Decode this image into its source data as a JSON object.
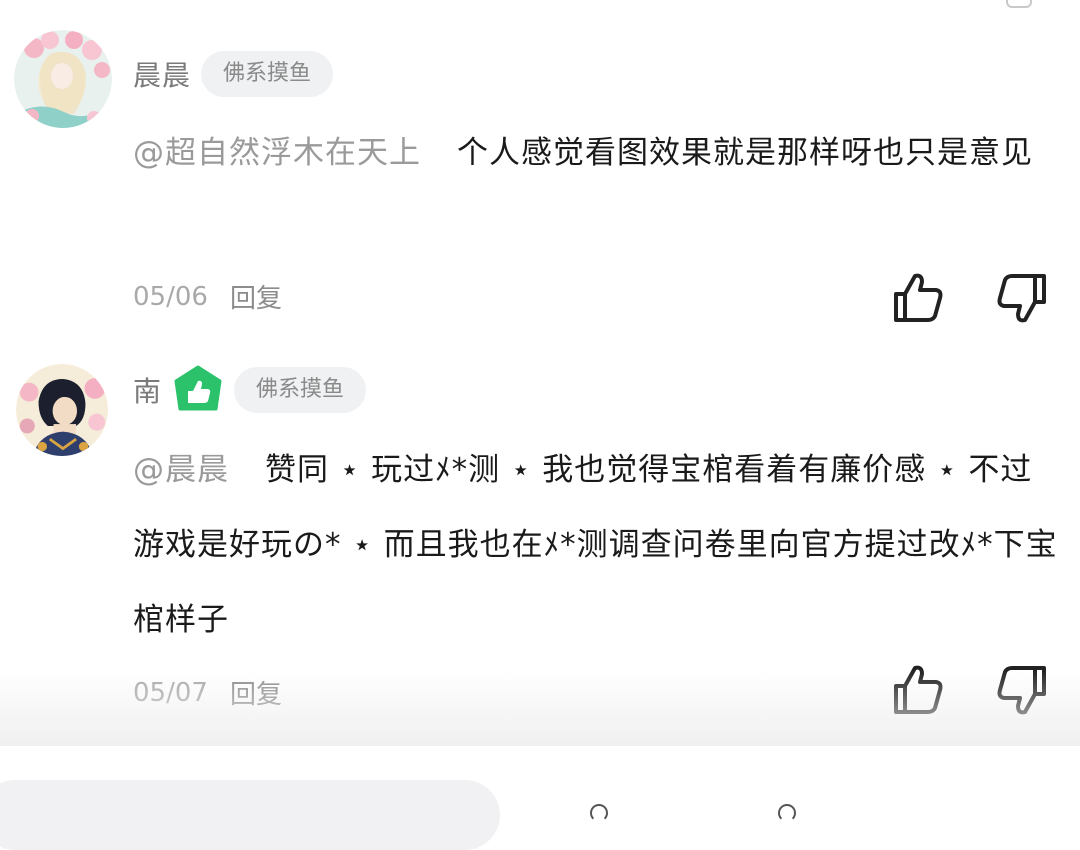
{
  "comments": [
    {
      "username": "晨晨",
      "badge": "佛系摸鱼",
      "mention": "@超自然浮木在天上",
      "text": "个人感觉看图效果就是那样呀也只是意见",
      "date": "05/06",
      "reply_label": "回复"
    },
    {
      "username": "南",
      "badge": "佛系摸鱼",
      "mention": "@晨晨",
      "text": "赞同 ⋆ 玩过ﾒ*测 ⋆ 我也觉得宝棺看着有廉价感 ⋆ 不过游戏是好玩の* ⋆ 而且我也在ﾒ*测调查问卷里向官方提过改ﾒ*下宝棺样子",
      "date": "05/07",
      "reply_label": "回复"
    }
  ],
  "icons": {
    "like": "thumbs-up-icon",
    "dislike": "thumbs-down-icon",
    "level": "level-badge-icon"
  },
  "colors": {
    "level_badge": "#2bc26b",
    "username": "#7a7a7a",
    "mention": "#9a9a9a",
    "text": "#1a1a1a"
  }
}
